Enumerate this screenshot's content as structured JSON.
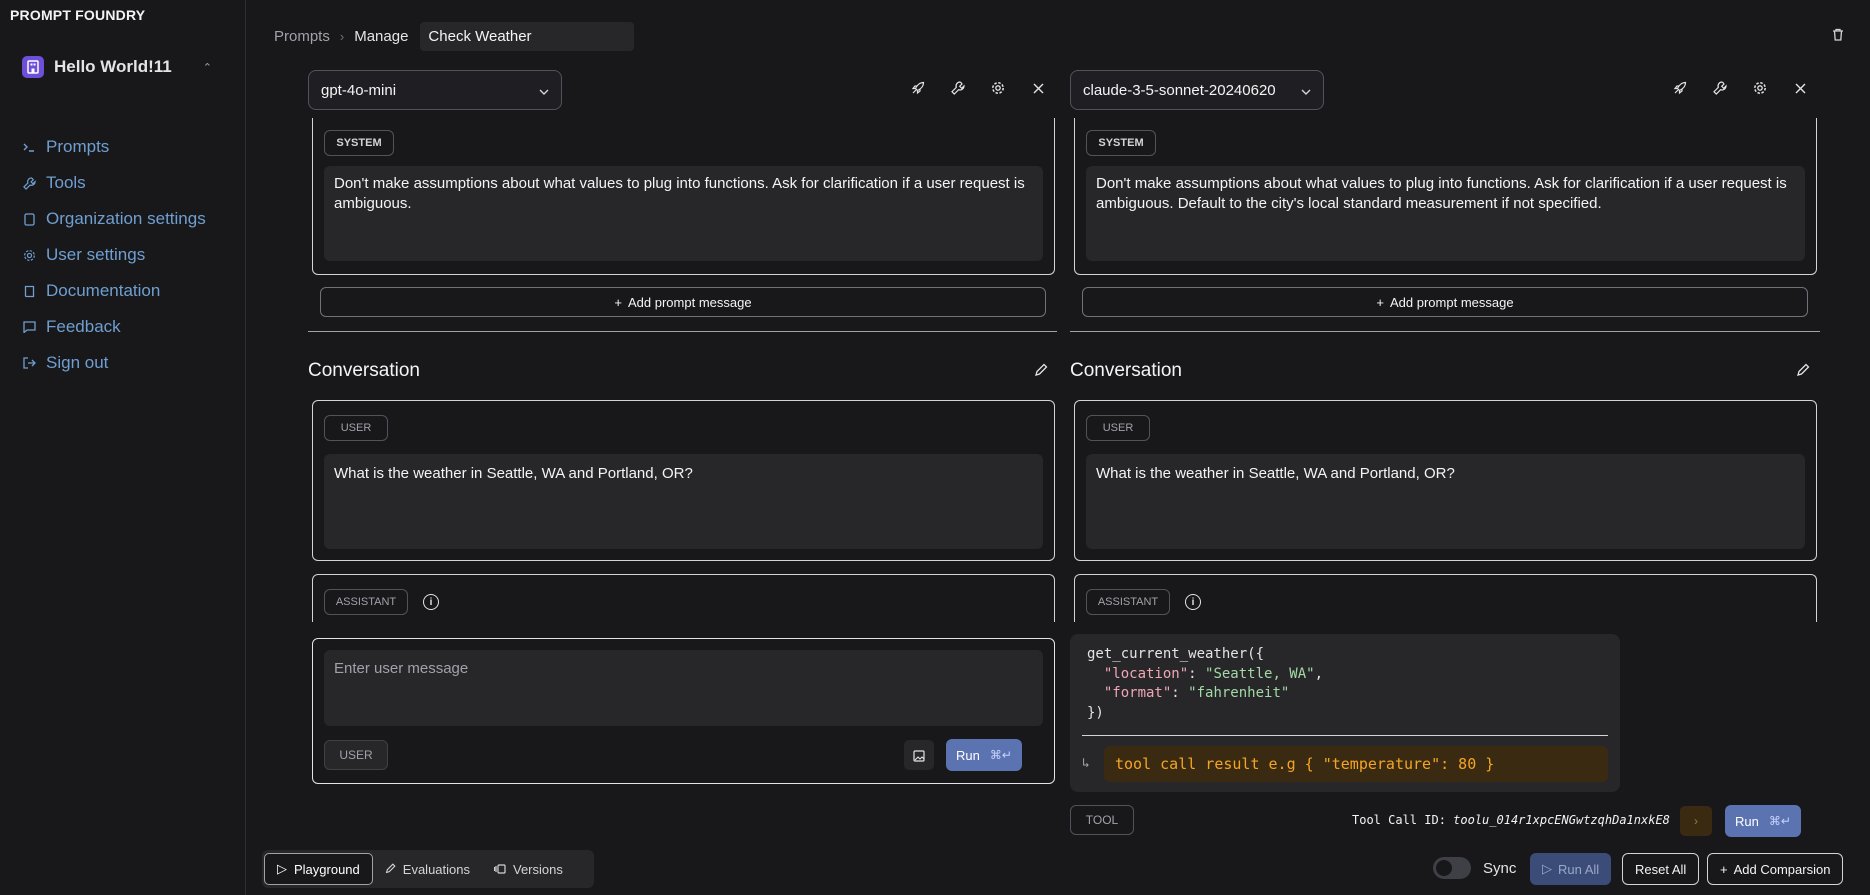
{
  "brand": "PROMPT FOUNDRY",
  "workspace": {
    "name": "Hello World!11"
  },
  "nav": {
    "items": [
      {
        "label": "Prompts",
        "icon": "terminal-icon"
      },
      {
        "label": "Tools",
        "icon": "wrench-icon"
      },
      {
        "label": "Organization settings",
        "icon": "building-icon"
      },
      {
        "label": "User settings",
        "icon": "gear-icon"
      },
      {
        "label": "Documentation",
        "icon": "book-icon"
      },
      {
        "label": "Feedback",
        "icon": "message-icon"
      },
      {
        "label": "Sign out",
        "icon": "sign-out-icon"
      }
    ]
  },
  "breadcrumb": {
    "root": "Prompts",
    "current": "Manage",
    "prompt_name": "Check Weather"
  },
  "panels": [
    {
      "model": "gpt-4o-mini",
      "system_role": "SYSTEM",
      "system_text": "Don't make assumptions about what values to plug into functions. Ask for clarification if a user request is ambiguous.",
      "add_prompt_label": "Add prompt message",
      "conversation_title": "Conversation",
      "user_role": "USER",
      "user_text": "What is the weather in Seattle, WA and Portland, OR?",
      "assistant_role": "ASSISTANT",
      "input_placeholder": "Enter user message",
      "input_role": "USER",
      "run_label": "Run",
      "run_shortcut": "⌘↵"
    },
    {
      "model": "claude-3-5-sonnet-20240620",
      "system_role": "SYSTEM",
      "system_text": "Don't make assumptions about what values to plug into functions. Ask for clarification if a user request is ambiguous.  Default to the city's local standard measurement if not specified.",
      "add_prompt_label": "Add prompt message",
      "conversation_title": "Conversation",
      "user_role": "USER",
      "user_text": "What is the weather in Seattle, WA and Portland, OR?",
      "assistant_role": "ASSISTANT",
      "tool_call": {
        "function": "get_current_weather",
        "location_key": "\"location\"",
        "location_value": "\"Seattle, WA\"",
        "format_key": "\"format\"",
        "format_value": "\"fahrenheit\"",
        "result_placeholder": "tool call result e.g { \"temperature\": 80 }"
      },
      "tool_role": "TOOL",
      "tool_call_id_label": "Tool Call ID:",
      "tool_call_id": "toolu_014r1xpcENGwtzqhDa1nxkE8",
      "run_label": "Run",
      "run_shortcut": "⌘↵"
    }
  ],
  "bottom": {
    "tabs": [
      "Playground",
      "Evaluations",
      "Versions"
    ],
    "sync_label": "Sync",
    "run_all": "Run All",
    "reset_all": "Reset All",
    "add_comparison": "Add Comparsion"
  },
  "colors": {
    "accent": "#5b73b0",
    "nav_link": "#6f9fd0",
    "tool_result_bg": "#3b2a12",
    "tool_result_text": "#f5a524"
  }
}
